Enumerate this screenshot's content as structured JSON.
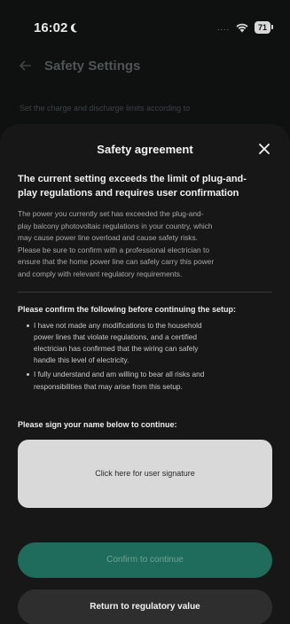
{
  "status_bar": {
    "time": "16:02",
    "moon_icon": "moon-icon",
    "signal": "....",
    "wifi_icon": "wifi-icon",
    "battery": "71"
  },
  "background_screen": {
    "back_icon": "back-arrow-icon",
    "title": "Safety Settings",
    "description": "Set the charge and discharge limits according to"
  },
  "modal": {
    "title": "Safety agreement",
    "close_icon": "close-icon",
    "warning_title": "The current setting exceeds the limit of plug-and-\nplay regulations and requires user confirmation",
    "warning_body": "The power you currently set has exceeded the plug-and-\nplay balcony photovoltaic regulations in your country, which\nmay cause power line overload and cause safety risks.\nPlease be sure to confirm with a professional electrician to\nensure that the home power line can safely carry this power\nand comply with relevant regulatory requirements.",
    "confirm_heading": "Please confirm the following before continuing the setup:",
    "confirm_items": [
      "I have not made any modifications to the household\npower lines that violate regulations, and a certified\nelectrician has confirmed that the wiring can safely\nhandle this level of electricity.",
      "I fully understand and am willing to bear all risks and\nresponsibilities that may arise from this setup."
    ],
    "sign_label": "Please sign your name below to continue:",
    "signature_placeholder": "Click here for user signature",
    "confirm_button": "Confirm to continue",
    "return_button": "Return to regulatory value"
  },
  "colors": {
    "accent": "#1f6b5c",
    "accent_text": "#6aa596",
    "sheet_bg": "#171717",
    "signature_bg": "#d9d9d9"
  }
}
